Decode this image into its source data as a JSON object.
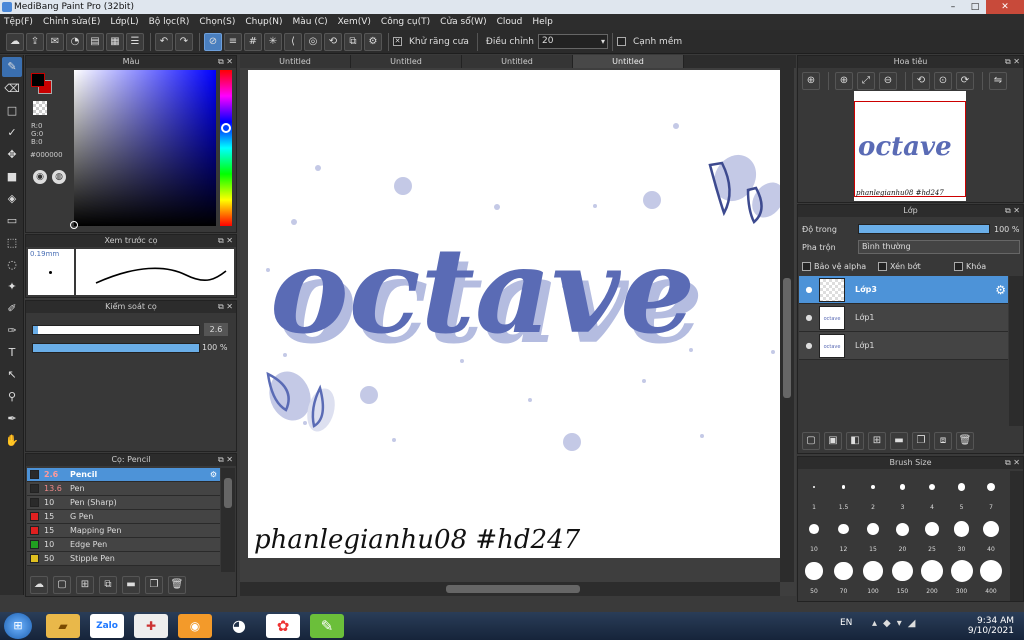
{
  "window": {
    "title": "MediBang Paint Pro (32bit)",
    "minimize": "–",
    "maximize": "□",
    "close": "✕"
  },
  "menu": [
    "Tệp(F)",
    "Chỉnh sửa(E)",
    "Lớp(L)",
    "Bộ lọc(R)",
    "Chọn(S)",
    "Chụp(N)",
    "Màu (C)",
    "Xem(V)",
    "Công cụ(T)",
    "Cửa sổ(W)",
    "Cloud",
    "Help"
  ],
  "toolbar": {
    "antialias_label": "Khử răng cưa",
    "antialias_checked": true,
    "correction_label": "Điều chỉnh",
    "correction_value": "20",
    "soft_edge_label": "Cạnh mềm",
    "soft_edge_checked": false
  },
  "color_panel": {
    "title": "Màu",
    "r": "R:0",
    "g": "G:0",
    "b": "B:0",
    "hex": "#000000",
    "main_color": "#000000",
    "accent_color": "#c80000"
  },
  "brush_preview": {
    "title": "Xem trước cọ",
    "size": "0.19mm"
  },
  "brush_control": {
    "title": "Kiểm soát cọ",
    "size_value": "2.6",
    "opacity_value": "100 %",
    "opacity": 1.0,
    "size_fraction": 0.03
  },
  "brush_list": {
    "title": "Cọ: Pencil",
    "items": [
      {
        "size": "2.6",
        "name": "Pencil",
        "color": "#2a2a2a",
        "selected": true
      },
      {
        "size": "13.6",
        "name": "Pen",
        "color": "#2a2a2a",
        "selected": false
      },
      {
        "size": "10",
        "name": "Pen (Sharp)",
        "color": "#2a2a2a",
        "selected": false
      },
      {
        "size": "15",
        "name": "G Pen",
        "color": "#e02020",
        "selected": false
      },
      {
        "size": "15",
        "name": "Mapping Pen",
        "color": "#e02020",
        "selected": false
      },
      {
        "size": "10",
        "name": "Edge Pen",
        "color": "#20a020",
        "selected": false
      },
      {
        "size": "50",
        "name": "Stipple Pen",
        "color": "#e0c020",
        "selected": false
      }
    ]
  },
  "tabs": [
    "Untitled",
    "Untitled",
    "Untitled",
    "Untitled"
  ],
  "canvas": {
    "title_word": "octave",
    "signature": "phanlegianhu08 #hd247",
    "letter_color": "#5a6bb5",
    "shadow_color": "#b4bce0"
  },
  "navigator": {
    "title": "Hoa tiêu"
  },
  "layers": {
    "title": "Lớp",
    "opacity_label": "Độ trong",
    "opacity_value": "100 %",
    "blend_label": "Pha trộn",
    "blend_value": "Bình thường",
    "protect_alpha": "Bảo vệ alpha",
    "clipping": "Xén bớt",
    "lock": "Khóa",
    "items": [
      {
        "name": "Lớp3",
        "selected": true
      },
      {
        "name": "Lớp1",
        "selected": false
      },
      {
        "name": "Lớp1",
        "selected": false
      }
    ]
  },
  "brush_size": {
    "title": "Brush Size",
    "sizes": [
      "1",
      "1.5",
      "2",
      "3",
      "4",
      "5",
      "7",
      "10",
      "12",
      "15",
      "20",
      "25",
      "30",
      "40",
      "50",
      "70",
      "100",
      "150",
      "200",
      "300",
      "400"
    ]
  },
  "taskbar": {
    "lang": "EN",
    "time": "9:34 AM",
    "date": "9/10/2021"
  }
}
